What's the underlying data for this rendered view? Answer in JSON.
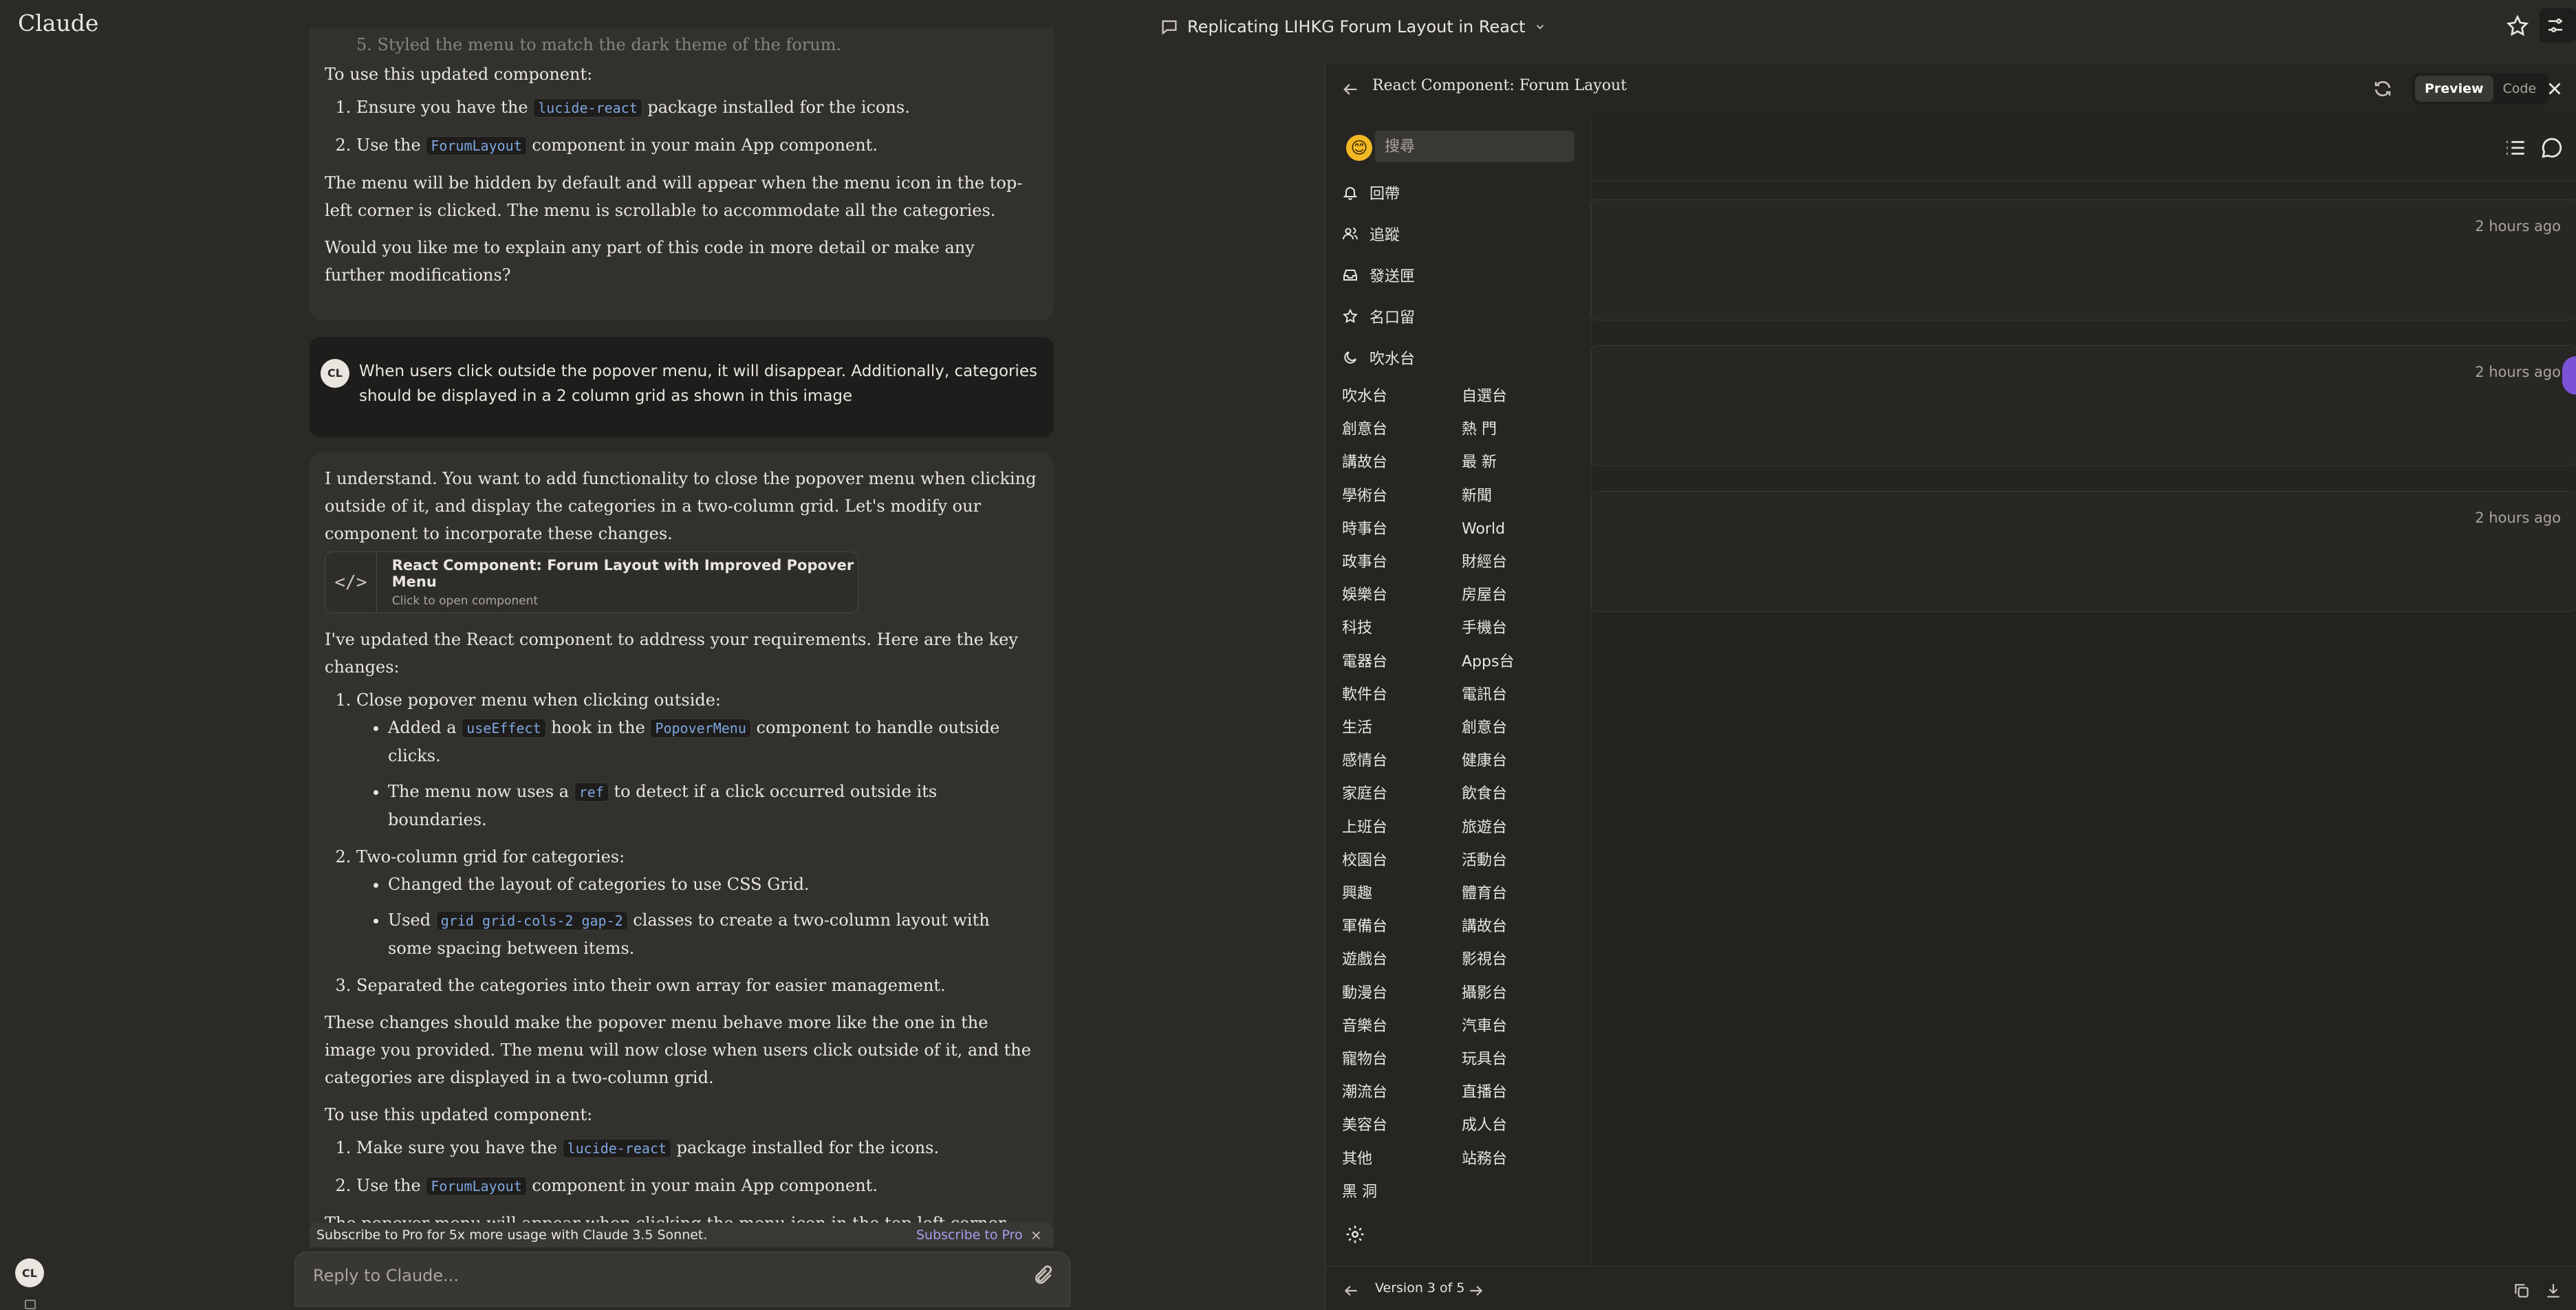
{
  "app": {
    "brand": "Claude",
    "chat_title": "Replicating LIHKG Forum Layout in React",
    "user_initials": "CL"
  },
  "chat": {
    "faded_line": "5. Styled the menu to match the dark theme of the forum.",
    "prev_use_intro": "To use this updated component:",
    "prev_steps": [
      {
        "before": "Ensure you have the ",
        "code": "lucide-react",
        "after": " package installed for the icons."
      },
      {
        "before": "Use the ",
        "code": "ForumLayout",
        "after": " component in your main App component."
      }
    ],
    "prev_p1": "The menu will be hidden by default and will appear when the menu icon in the top-left corner is clicked. The menu is scrollable to accommodate all the categories.",
    "prev_p2": "Would you like me to explain any part of this code in more detail or make any further modifications?",
    "user_message": "When users click outside the popover menu, it will disappear. Additionally, categories should be displayed in a 2 column grid as shown in this image",
    "resp_intro": "I understand. You want to add functionality to close the popover menu when clicking outside of it, and display the categories in a two-column grid. Let's modify our component to incorporate these changes.",
    "artifact_card": {
      "title": "React Component: Forum Layout with Improved Popover Menu",
      "subtitle": "Click to open component",
      "icon": "code-icon"
    },
    "changes_intro": "I've updated the React component to address your requirements. Here are the key changes:",
    "change1_title": "Close popover menu when clicking outside:",
    "change1_b1": {
      "before": "Added a ",
      "code1": "useEffect",
      "mid": " hook in the ",
      "code2": "PopoverMenu",
      "after": " component to handle outside clicks."
    },
    "change1_b2": {
      "before": "The menu now uses a ",
      "code": "ref",
      "after": " to detect if a click occurred outside its boundaries."
    },
    "change2_title": "Two-column grid for categories:",
    "change2_b1": "Changed the layout of categories to use CSS Grid.",
    "change2_b2": {
      "before": "Used ",
      "code": "grid grid-cols-2 gap-2",
      "after": " classes to create a two-column layout with some spacing between items."
    },
    "change3": "Separated the categories into their own array for easier management.",
    "resp_p2": "These changes should make the popover menu behave more like the one in the image you provided. The menu will now close when users click outside of it, and the categories are displayed in a two-column grid.",
    "use_intro": "To use this updated component:",
    "steps": [
      {
        "before": "Make sure you have the ",
        "code": "lucide-react",
        "after": " package installed for the icons."
      },
      {
        "before": "Use the ",
        "code": "ForumLayout",
        "after": " component in your main App component."
      }
    ],
    "resp_p3": "The popover menu will appear when clicking the menu icon in the top-left corner and disappear when clicking outside of it. The categories are now displayed in a two-column grid within the menu."
  },
  "subscribe": {
    "text": "Subscribe to Pro for 5x more usage with Claude 3.5 Sonnet.",
    "cta": "Subscribe to Pro",
    "close": "×"
  },
  "reply": {
    "placeholder": "Reply to Claude..."
  },
  "panel": {
    "title": "React Component: Forum Layout",
    "tab_preview": "Preview",
    "tab_code": "Code",
    "version": "Version 3 of 5"
  },
  "forum": {
    "search_placeholder": "搜尋",
    "emoji": "😊",
    "menu_items": [
      {
        "label": "回帶",
        "icon": "bell-icon"
      },
      {
        "label": "追蹤",
        "icon": "users-icon"
      },
      {
        "label": "發送匣",
        "icon": "inbox-icon"
      },
      {
        "label": "名口留",
        "icon": "star-icon"
      },
      {
        "label": "吹水台",
        "icon": "moon-icon"
      }
    ],
    "categories_left": [
      "吹水台",
      "創意台",
      "講故台",
      "學術台",
      "時事台",
      "政事台",
      "娛樂台",
      "科技",
      "電器台",
      "軟件台",
      "生活",
      "感情台",
      "家庭台",
      "上班台",
      "校園台",
      "興趣",
      "軍備台",
      "遊戲台",
      "動漫台",
      "音樂台",
      "寵物台",
      "潮流台",
      "美容台",
      "其他",
      "黑 洞"
    ],
    "categories_right": [
      "自選台",
      "熱 門",
      "最 新",
      "新聞",
      "World",
      "財經台",
      "房屋台",
      "手機台",
      "Apps台",
      "電訊台",
      "創意台",
      "健康台",
      "飲食台",
      "旅遊台",
      "活動台",
      "體育台",
      "講故台",
      "影視台",
      "攝影台",
      "汽車台",
      "玩具台",
      "直播台",
      "成人台",
      "站務台"
    ],
    "posts": [
      {
        "time": "2 hours ago"
      },
      {
        "time": "2 hours ago"
      },
      {
        "time": "2 hours ago"
      }
    ]
  }
}
